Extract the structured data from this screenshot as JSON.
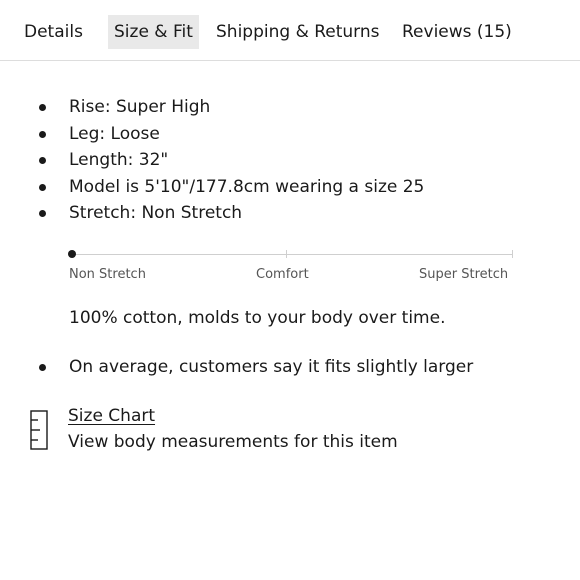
{
  "tabs": [
    {
      "label": "Details"
    },
    {
      "label": "Size & Fit",
      "active": true
    },
    {
      "label": "Shipping & Returns"
    },
    {
      "label": "Reviews (15)"
    }
  ],
  "specs": [
    "Rise: Super High",
    "Leg: Loose",
    "Length: 32\"",
    "Model is 5'10\"/177.8cm wearing a size 25",
    "Stretch: Non Stretch"
  ],
  "stretch_scale": {
    "labels": [
      "Non Stretch",
      "Comfort",
      "Super Stretch"
    ],
    "selected_index": 0
  },
  "material_note": "100% cotton, molds to your body over time.",
  "fit_note": "On average, customers say it fits slightly larger",
  "size_chart": {
    "title": "Size Chart",
    "subtitle": "View body measurements for this item",
    "icon": "ruler-icon"
  }
}
